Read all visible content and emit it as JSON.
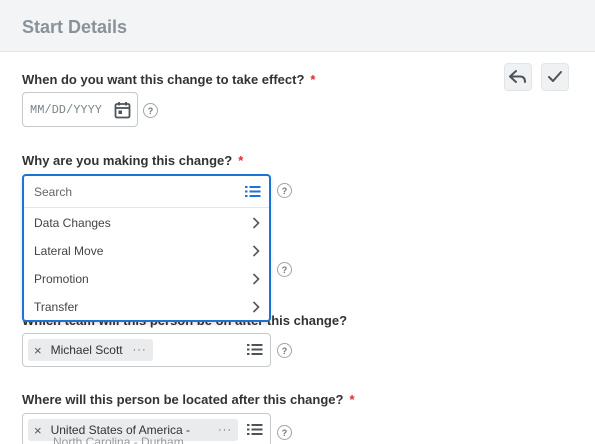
{
  "header": {
    "title": "Start Details"
  },
  "actions": {
    "back_icon": "reply-arrow-icon",
    "submit_icon": "checkmark-icon"
  },
  "fields": {
    "effective_date": {
      "label": "When do you want this change to take effect?",
      "required_mark": "*",
      "placeholder": "MM/DD/YYYY",
      "help": "?"
    },
    "reason": {
      "label": "Why are you making this change?",
      "required_mark": "*",
      "search_placeholder": "Search",
      "help": "?",
      "options": [
        "Data Changes",
        "Lateral Move",
        "Promotion",
        "Transfer"
      ]
    },
    "team": {
      "label": "Which team will this person be on after this change?",
      "help": "?",
      "selected": {
        "value": "Michael Scott",
        "remove": "×",
        "more": "···"
      }
    },
    "location": {
      "label": "Where will this person be located after this change?",
      "required_mark": "*",
      "help": "?",
      "selected": {
        "value": "United States of America -",
        "value_line2": "North Carolina - Durham",
        "remove": "×",
        "more": "···"
      }
    }
  },
  "colors": {
    "accent": "#1d72d6",
    "required": "#de2b2b",
    "header_bg": "#f2f4f5"
  }
}
